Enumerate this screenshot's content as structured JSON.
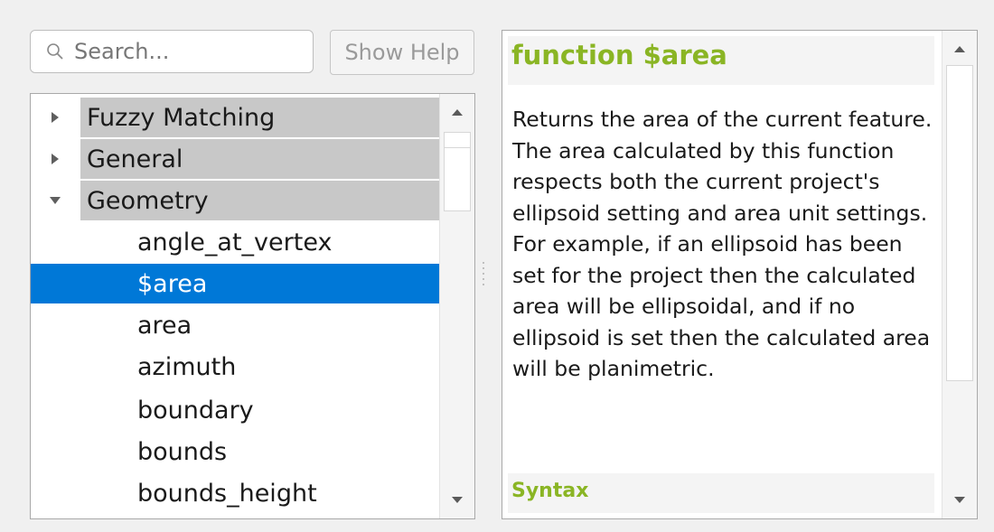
{
  "search": {
    "placeholder": "Search...",
    "value": ""
  },
  "help_button": {
    "label": "Show Help"
  },
  "tree": {
    "groups": [
      {
        "label": "Fuzzy Matching",
        "expanded": false
      },
      {
        "label": "General",
        "expanded": false
      },
      {
        "label": "Geometry",
        "expanded": true
      }
    ],
    "children": [
      "angle_at_vertex",
      "$area",
      "area",
      "azimuth",
      "boundary",
      "bounds",
      "bounds_height"
    ],
    "selected": "$area"
  },
  "help": {
    "title": "function $area",
    "description": "Returns the area of the current feature. The area calculated by this function respects both the current project's ellipsoid setting and area unit settings. For example, if an ellipsoid has been set for the project then the calculated area will be ellipsoidal, and if no ellipsoid is set then the calculated area will be planimetric.",
    "syntax_heading": "Syntax"
  },
  "colors": {
    "selection": "#0078d7",
    "heading": "#8ab524",
    "group_highlight": "#c8c8c8"
  }
}
